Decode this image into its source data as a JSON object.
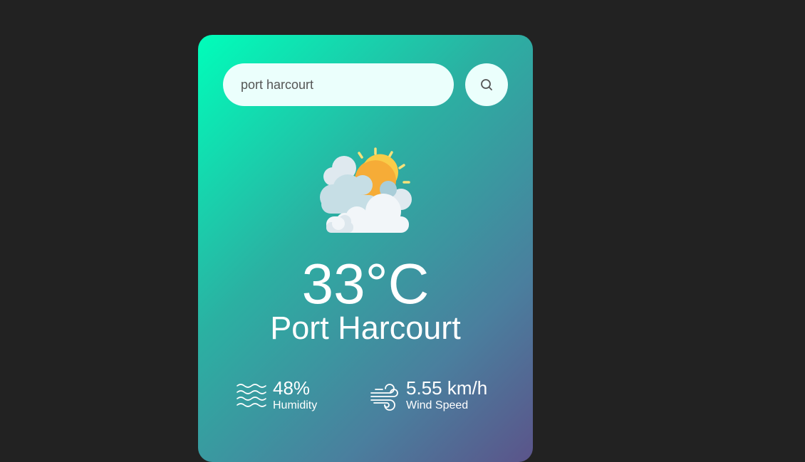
{
  "search": {
    "value": "port harcourt",
    "icon": "search-icon"
  },
  "weather": {
    "icon": "partly-cloudy-sun-icon",
    "temperature": "33°C",
    "city": "Port Harcourt"
  },
  "details": {
    "humidity": {
      "value": "48%",
      "label": "Humidity",
      "icon": "humidity-waves-icon"
    },
    "wind": {
      "value": "5.55 km/h",
      "label": "Wind Speed",
      "icon": "wind-icon"
    }
  },
  "colors": {
    "page_background": "#222222",
    "gradient_start": "#00feba",
    "gradient_end": "#5b548a",
    "input_background": "#ebfffc",
    "text": "#ffffff"
  }
}
